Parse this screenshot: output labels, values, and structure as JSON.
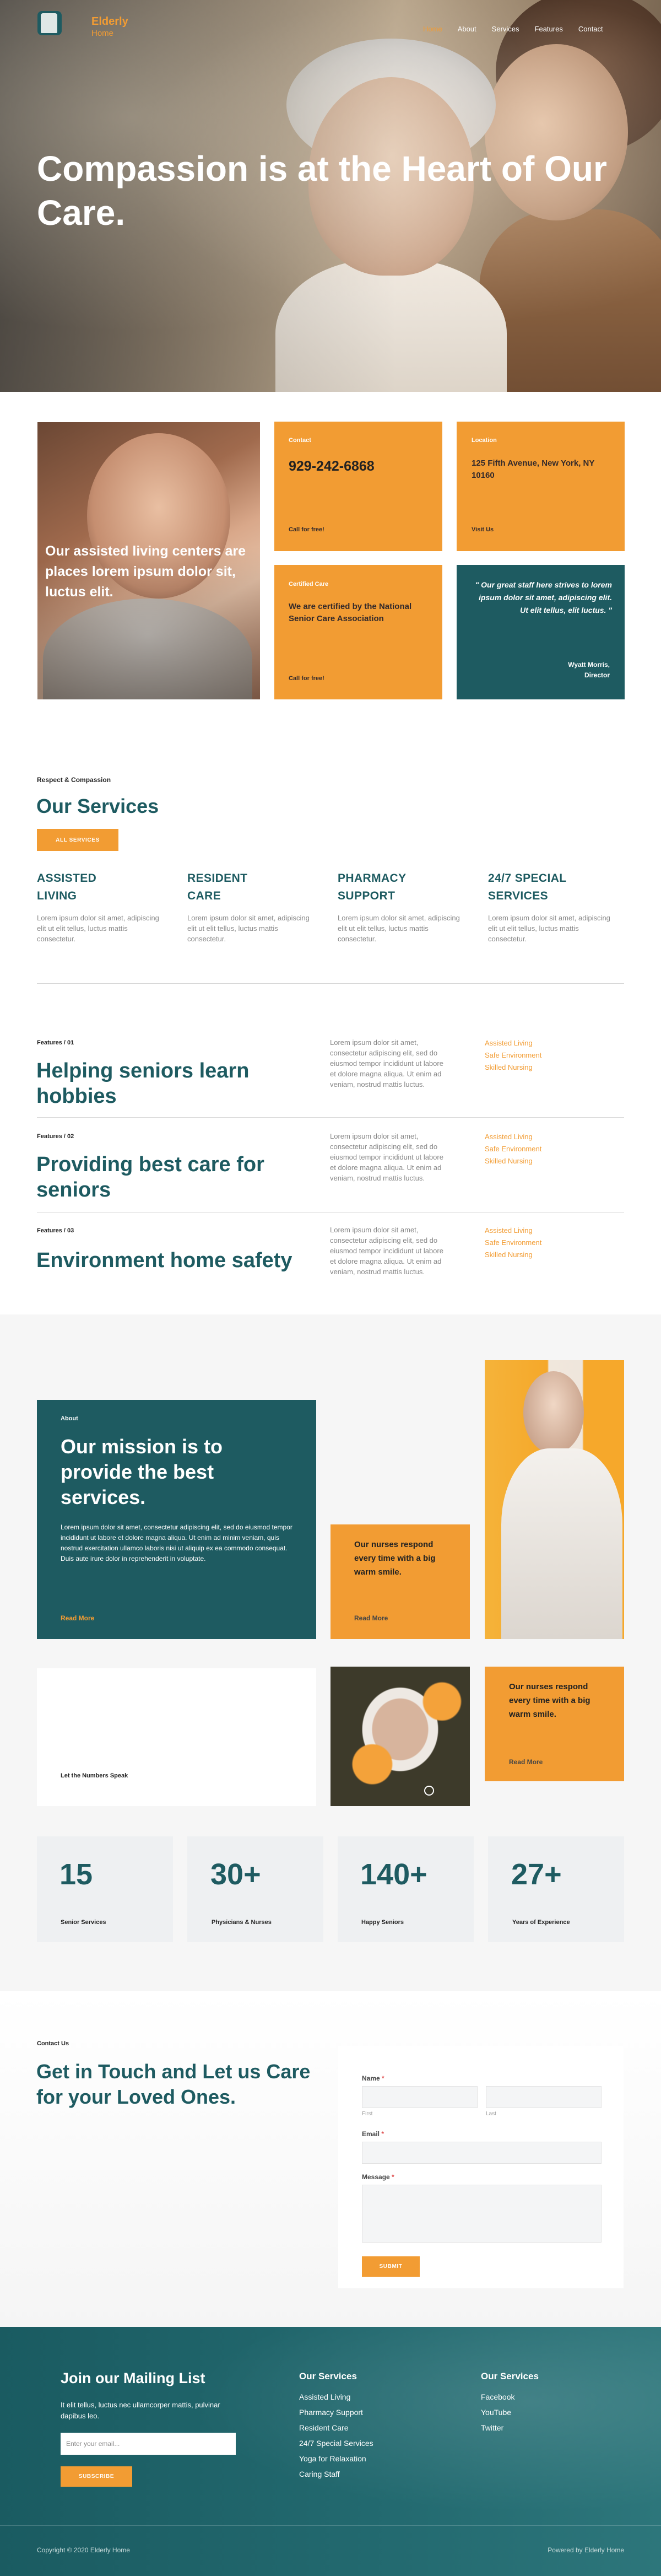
{
  "nav": {
    "brand_line1": "Elderly",
    "brand_line2": "Home",
    "items": [
      "Home",
      "About",
      "Services",
      "Features",
      "Contact"
    ]
  },
  "hero": {
    "title": "Compassion is at the Heart of Our Care."
  },
  "intro": {
    "photo_caption": "Our assisted living centers are places lorem ipsum dolor sit, luctus elit.",
    "contact": {
      "label": "Contact",
      "phone": "929-242-6868",
      "link": "Call for free!"
    },
    "location": {
      "label": "Location",
      "address": "125 Fifth Avenue, New York, NY 10160",
      "link": "Visit Us"
    },
    "certified": {
      "label": "Certified Care",
      "text": "We are certified by the National Senior Care Association",
      "link": "Call for free!"
    },
    "quote": {
      "text": "\" Our great staff here strives to lorem ipsum dolor sit amet, adipiscing elit. Ut elit tellus, elit luctus. \"",
      "name": "Wyatt Morris,",
      "role": "Director"
    }
  },
  "services": {
    "eyebrow": "Respect & Compassion",
    "title": "Our Services",
    "button": "ALL SERVICES",
    "items": [
      {
        "title_l1": "ASSISTED",
        "title_l2": "LIVING",
        "body": "Lorem ipsum dolor sit amet, adipiscing elit ut elit tellus, luctus mattis consectetur."
      },
      {
        "title_l1": "RESIDENT",
        "title_l2": "CARE",
        "body": "Lorem ipsum dolor sit amet, adipiscing elit ut elit tellus, luctus mattis consectetur."
      },
      {
        "title_l1": "PHARMACY",
        "title_l2": "SUPPORT",
        "body": "Lorem ipsum dolor sit amet, adipiscing elit ut elit tellus, luctus mattis consectetur."
      },
      {
        "title_l1": "24/7 SPECIAL",
        "title_l2": "SERVICES",
        "body": "Lorem ipsum dolor sit amet, adipiscing elit ut elit tellus, luctus mattis consectetur."
      }
    ]
  },
  "features": {
    "body": "Lorem ipsum dolor sit amet, consectetur adipiscing elit, sed do eiusmod tempor incididunt ut labore et dolore magna aliqua. Ut enim ad veniam, nostrud mattis luctus.",
    "links": [
      "Assisted Living",
      "Safe Environment",
      "Skilled Nursing"
    ],
    "items": [
      {
        "label": "Features / 01",
        "title_l1": "Helping seniors learn",
        "title_l2": "hobbies"
      },
      {
        "label": "Features / 02",
        "title_l1": "Providing best care for",
        "title_l2": "seniors"
      },
      {
        "label": "Features / 03",
        "title_l1": "Environment home safety",
        "title_l2": ""
      }
    ]
  },
  "about": {
    "label": "About",
    "title": "Our mission is to provide the best services.",
    "body": "Lorem ipsum dolor sit amet, consectetur adipiscing elit, sed do eiusmod tempor incididunt ut labore et dolore magna aliqua. Ut enim ad minim veniam, quis nostrud exercitation ullamco laboris nisi ut aliquip ex ea commodo consequat. Duis aute irure dolor in reprehenderit in voluptate.",
    "link": "Read More",
    "nurse_card_1": {
      "text": "Our nurses respond every time with a big warm smile.",
      "link": "Read More"
    },
    "nurse_card_2": {
      "text": "Our nurses respond every time with a big warm smile.",
      "link": "Read More"
    },
    "numbers_label": "Let the Numbers Speak"
  },
  "stats": [
    {
      "value": "15",
      "label": "Senior Services"
    },
    {
      "value": "30+",
      "label": "Physicians & Nurses"
    },
    {
      "value": "140+",
      "label": "Happy Seniors"
    },
    {
      "value": "27+",
      "label": "Years of Experience"
    }
  ],
  "contact": {
    "label": "Contact Us",
    "title": "Get in Touch and Let us Care for your Loved Ones.",
    "name_label": "Name",
    "first_label": "First",
    "last_label": "Last",
    "email_label": "Email",
    "message_label": "Message",
    "required_mark": "*",
    "submit": "SUBMIT"
  },
  "footer": {
    "mailing_title": "Join our Mailing List",
    "mailing_text": "It elit tellus, luctus nec ullamcorper mattis, pulvinar dapibus leo.",
    "email_placeholder": "Enter your email...",
    "subscribe": "SUBSCRIBE",
    "services_title": "Our Services",
    "services": [
      "Assisted Living",
      "Pharmacy Support",
      "Resident Care",
      "24/7 Special Services",
      "Yoga for Relaxation",
      "Caring Staff"
    ],
    "social_title": "Our Services",
    "social": [
      "Facebook",
      "YouTube",
      "Twitter"
    ],
    "copyright": "Copyright © 2020 Elderly Home",
    "powered": "Powered by Elderly Home"
  }
}
